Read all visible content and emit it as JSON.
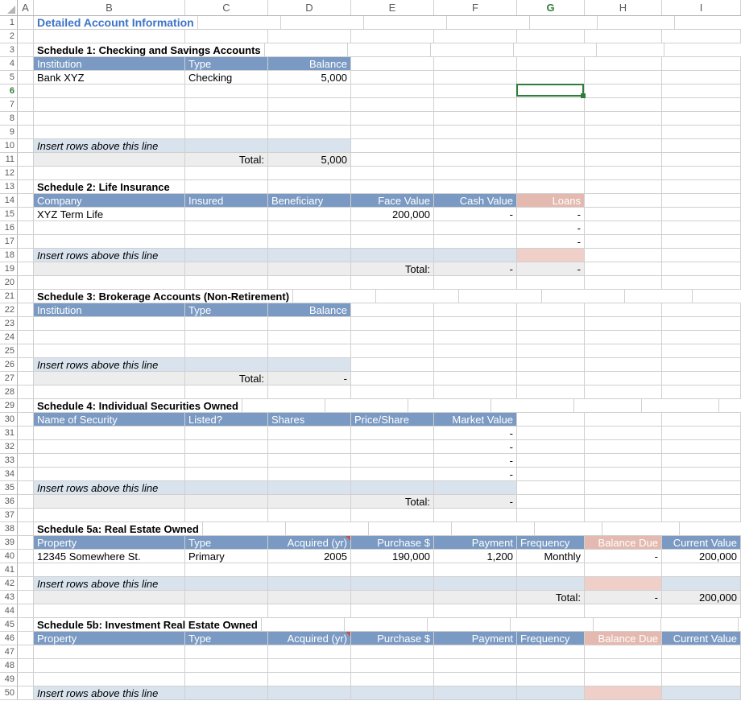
{
  "columns": [
    "A",
    "B",
    "C",
    "D",
    "E",
    "F",
    "G",
    "H",
    "I"
  ],
  "selected": {
    "col": "G",
    "row": 6
  },
  "title": "Detailed Account Information",
  "insert_line": "Insert rows above this line",
  "total_label": "Total:",
  "s1": {
    "title": "Schedule 1: Checking and Savings Accounts",
    "headers": {
      "b": "Institution",
      "c": "Type",
      "d": "Balance"
    },
    "rows": [
      {
        "b": "Bank XYZ",
        "c": "Checking",
        "d": "5,000"
      }
    ],
    "total": "5,000"
  },
  "s2": {
    "title": "Schedule 2: Life Insurance",
    "headers": {
      "b": "Company",
      "c": "Insured",
      "d": "Beneficiary",
      "e": "Face Value",
      "f": "Cash Value",
      "g": "Loans"
    },
    "rows": [
      {
        "b": "XYZ Term Life",
        "c": "",
        "d": "",
        "e": "200,000",
        "f": "-",
        "g": "-"
      },
      {
        "g": "-"
      },
      {
        "g": "-"
      }
    ],
    "total": {
      "f": "-",
      "g": "-"
    }
  },
  "s3": {
    "title": "Schedule 3: Brokerage Accounts (Non-Retirement)",
    "headers": {
      "b": "Institution",
      "c": "Type",
      "d": "Balance"
    },
    "total": "-"
  },
  "s4": {
    "title": "Schedule 4: Individual Securities Owned",
    "headers": {
      "b": "Name of Security",
      "c": "Listed?",
      "d": "Shares",
      "e": "Price/Share",
      "f": "Market Value"
    },
    "rows": [
      {
        "f": "-"
      },
      {
        "f": "-"
      },
      {
        "f": "-"
      },
      {
        "f": "-"
      }
    ],
    "total": {
      "f": "-"
    }
  },
  "s5a": {
    "title": "Schedule 5a: Real Estate Owned",
    "headers": {
      "b": "Property",
      "c": "Type",
      "d": "Acquired (yr)",
      "e": "Purchase $",
      "f": "Payment",
      "g": "Frequency",
      "h": "Balance Due",
      "i": "Current Value"
    },
    "rows": [
      {
        "b": "12345 Somewhere St.",
        "c": "Primary",
        "d": "2005",
        "e": "190,000",
        "f": "1,200",
        "g": "Monthly",
        "h": "-",
        "i": "200,000"
      }
    ],
    "total": {
      "h": "-",
      "i": "200,000"
    }
  },
  "s5b": {
    "title": "Schedule 5b: Investment Real Estate Owned",
    "headers": {
      "b": "Property",
      "c": "Type",
      "d": "Acquired (yr)",
      "e": "Purchase $",
      "f": "Payment",
      "g": "Frequency",
      "h": "Balance Due",
      "i": "Current Value"
    }
  }
}
